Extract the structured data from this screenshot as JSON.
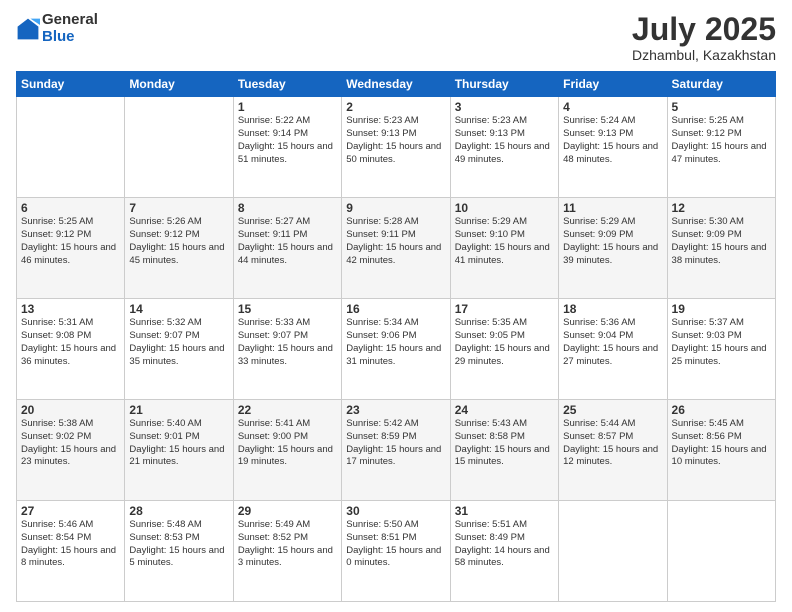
{
  "logo": {
    "general": "General",
    "blue": "Blue"
  },
  "title": "July 2025",
  "location": "Dzhambul, Kazakhstan",
  "days_of_week": [
    "Sunday",
    "Monday",
    "Tuesday",
    "Wednesday",
    "Thursday",
    "Friday",
    "Saturday"
  ],
  "weeks": [
    [
      {
        "day": "",
        "detail": ""
      },
      {
        "day": "",
        "detail": ""
      },
      {
        "day": "1",
        "sunrise": "5:22 AM",
        "sunset": "9:14 PM",
        "daylight": "15 hours and 51 minutes."
      },
      {
        "day": "2",
        "sunrise": "5:23 AM",
        "sunset": "9:13 PM",
        "daylight": "15 hours and 50 minutes."
      },
      {
        "day": "3",
        "sunrise": "5:23 AM",
        "sunset": "9:13 PM",
        "daylight": "15 hours and 49 minutes."
      },
      {
        "day": "4",
        "sunrise": "5:24 AM",
        "sunset": "9:13 PM",
        "daylight": "15 hours and 48 minutes."
      },
      {
        "day": "5",
        "sunrise": "5:25 AM",
        "sunset": "9:12 PM",
        "daylight": "15 hours and 47 minutes."
      }
    ],
    [
      {
        "day": "6",
        "sunrise": "5:25 AM",
        "sunset": "9:12 PM",
        "daylight": "15 hours and 46 minutes."
      },
      {
        "day": "7",
        "sunrise": "5:26 AM",
        "sunset": "9:12 PM",
        "daylight": "15 hours and 45 minutes."
      },
      {
        "day": "8",
        "sunrise": "5:27 AM",
        "sunset": "9:11 PM",
        "daylight": "15 hours and 44 minutes."
      },
      {
        "day": "9",
        "sunrise": "5:28 AM",
        "sunset": "9:11 PM",
        "daylight": "15 hours and 42 minutes."
      },
      {
        "day": "10",
        "sunrise": "5:29 AM",
        "sunset": "9:10 PM",
        "daylight": "15 hours and 41 minutes."
      },
      {
        "day": "11",
        "sunrise": "5:29 AM",
        "sunset": "9:09 PM",
        "daylight": "15 hours and 39 minutes."
      },
      {
        "day": "12",
        "sunrise": "5:30 AM",
        "sunset": "9:09 PM",
        "daylight": "15 hours and 38 minutes."
      }
    ],
    [
      {
        "day": "13",
        "sunrise": "5:31 AM",
        "sunset": "9:08 PM",
        "daylight": "15 hours and 36 minutes."
      },
      {
        "day": "14",
        "sunrise": "5:32 AM",
        "sunset": "9:07 PM",
        "daylight": "15 hours and 35 minutes."
      },
      {
        "day": "15",
        "sunrise": "5:33 AM",
        "sunset": "9:07 PM",
        "daylight": "15 hours and 33 minutes."
      },
      {
        "day": "16",
        "sunrise": "5:34 AM",
        "sunset": "9:06 PM",
        "daylight": "15 hours and 31 minutes."
      },
      {
        "day": "17",
        "sunrise": "5:35 AM",
        "sunset": "9:05 PM",
        "daylight": "15 hours and 29 minutes."
      },
      {
        "day": "18",
        "sunrise": "5:36 AM",
        "sunset": "9:04 PM",
        "daylight": "15 hours and 27 minutes."
      },
      {
        "day": "19",
        "sunrise": "5:37 AM",
        "sunset": "9:03 PM",
        "daylight": "15 hours and 25 minutes."
      }
    ],
    [
      {
        "day": "20",
        "sunrise": "5:38 AM",
        "sunset": "9:02 PM",
        "daylight": "15 hours and 23 minutes."
      },
      {
        "day": "21",
        "sunrise": "5:40 AM",
        "sunset": "9:01 PM",
        "daylight": "15 hours and 21 minutes."
      },
      {
        "day": "22",
        "sunrise": "5:41 AM",
        "sunset": "9:00 PM",
        "daylight": "15 hours and 19 minutes."
      },
      {
        "day": "23",
        "sunrise": "5:42 AM",
        "sunset": "8:59 PM",
        "daylight": "15 hours and 17 minutes."
      },
      {
        "day": "24",
        "sunrise": "5:43 AM",
        "sunset": "8:58 PM",
        "daylight": "15 hours and 15 minutes."
      },
      {
        "day": "25",
        "sunrise": "5:44 AM",
        "sunset": "8:57 PM",
        "daylight": "15 hours and 12 minutes."
      },
      {
        "day": "26",
        "sunrise": "5:45 AM",
        "sunset": "8:56 PM",
        "daylight": "15 hours and 10 minutes."
      }
    ],
    [
      {
        "day": "27",
        "sunrise": "5:46 AM",
        "sunset": "8:54 PM",
        "daylight": "15 hours and 8 minutes."
      },
      {
        "day": "28",
        "sunrise": "5:48 AM",
        "sunset": "8:53 PM",
        "daylight": "15 hours and 5 minutes."
      },
      {
        "day": "29",
        "sunrise": "5:49 AM",
        "sunset": "8:52 PM",
        "daylight": "15 hours and 3 minutes."
      },
      {
        "day": "30",
        "sunrise": "5:50 AM",
        "sunset": "8:51 PM",
        "daylight": "15 hours and 0 minutes."
      },
      {
        "day": "31",
        "sunrise": "5:51 AM",
        "sunset": "8:49 PM",
        "daylight": "14 hours and 58 minutes."
      },
      {
        "day": "",
        "detail": ""
      },
      {
        "day": "",
        "detail": ""
      }
    ]
  ]
}
